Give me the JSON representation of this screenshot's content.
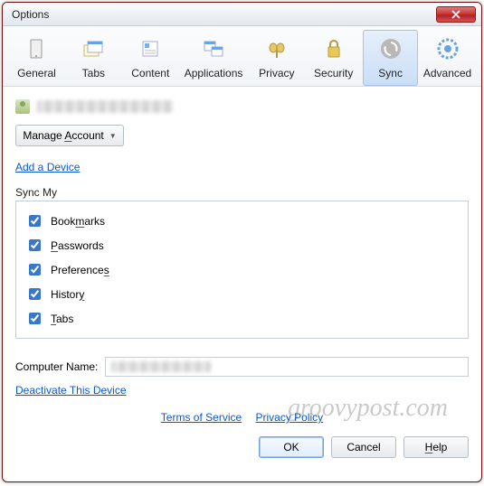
{
  "window": {
    "title": "Options"
  },
  "toolbar": {
    "items": [
      {
        "label": "General"
      },
      {
        "label": "Tabs"
      },
      {
        "label": "Content"
      },
      {
        "label": "Applications"
      },
      {
        "label": "Privacy"
      },
      {
        "label": "Security"
      },
      {
        "label": "Sync"
      },
      {
        "label": "Advanced"
      }
    ]
  },
  "manage_account": "Manage Account",
  "add_device": "Add a Device",
  "sync_my": "Sync My",
  "sync_items": {
    "bookmarks": "Bookmarks",
    "passwords": "Passwords",
    "preferences": "Preferences",
    "history": "History",
    "tabs": "Tabs"
  },
  "computer_name_label": "Computer Name:",
  "deactivate": "Deactivate This Device",
  "terms": "Terms of Service",
  "privacy": "Privacy Policy",
  "buttons": {
    "ok": "OK",
    "cancel": "Cancel",
    "help": "Help"
  },
  "watermark": "groovypost.com"
}
